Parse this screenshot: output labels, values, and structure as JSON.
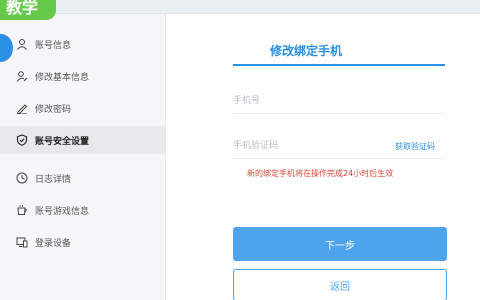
{
  "badge": "教学",
  "sidebar": {
    "items": [
      {
        "label": "账号信息",
        "icon": "user-icon",
        "active": false
      },
      {
        "label": "修改基本信息",
        "icon": "user-edit-icon",
        "active": false
      },
      {
        "label": "修改密码",
        "icon": "pencil-icon",
        "active": false
      },
      {
        "label": "账号安全设置",
        "icon": "shield-icon",
        "active": true
      },
      {
        "label": "日志详情",
        "icon": "clock-icon",
        "active": false
      },
      {
        "label": "账号游戏信息",
        "icon": "cup-icon",
        "active": false
      },
      {
        "label": "登录设备",
        "icon": "device-icon",
        "active": false
      }
    ]
  },
  "form": {
    "title": "修改绑定手机",
    "phone_placeholder": "手机号",
    "phone_value": "",
    "code_placeholder": "手机验证码",
    "code_value": "",
    "get_code_label": "获取验证码",
    "notice": "新的绑定手机将在操作完成24小时后生效",
    "next_label": "下一步",
    "back_label": "返回"
  },
  "colors": {
    "accent": "#2c8fe6",
    "button": "#4ea4ec",
    "notice": "#e0463a",
    "badge": "#66c94c"
  }
}
